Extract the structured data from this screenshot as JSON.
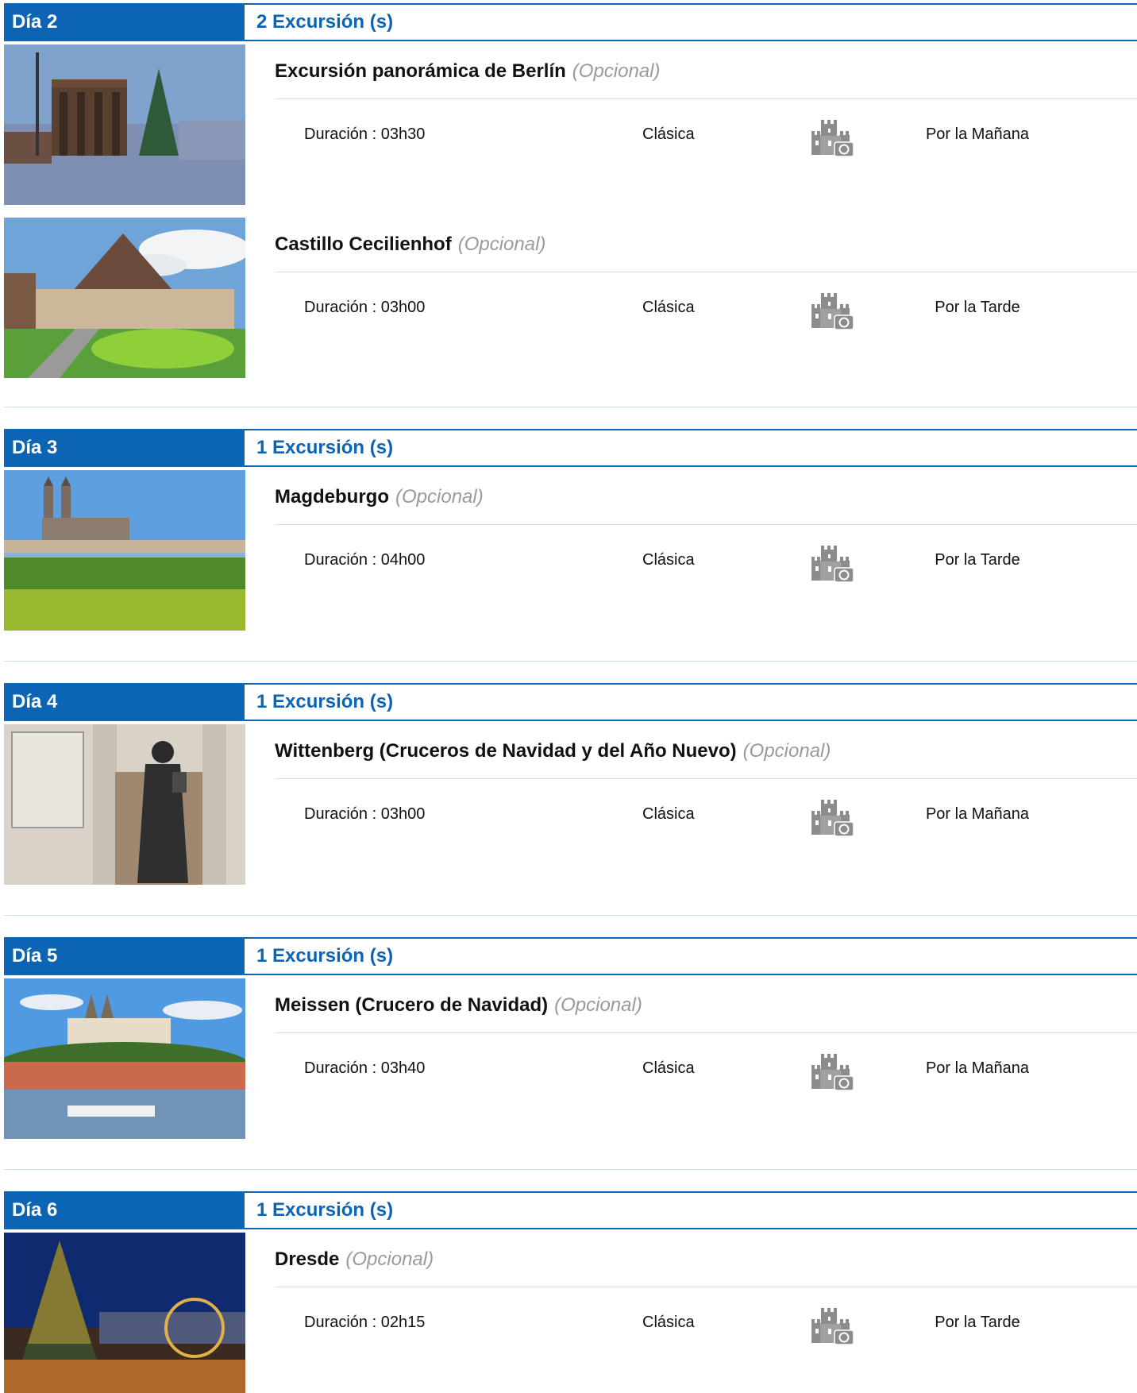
{
  "days": [
    {
      "label": "Día 2",
      "count": "2 Excursión (s)",
      "excursions": [
        {
          "name": "Excursión panorámica de Berlín",
          "optional": "(Opcional)",
          "duration": "Duración : 03h30",
          "type": "Clásica",
          "period": "Por la Mañana",
          "icon": "castle-camera-icon"
        },
        {
          "name": "Castillo Cecilienhof",
          "optional": "(Opcional)",
          "duration": "Duración : 03h00",
          "type": "Clásica",
          "period": "Por la Tarde",
          "icon": "castle-camera-icon"
        }
      ]
    },
    {
      "label": "Día 3",
      "count": "1 Excursión (s)",
      "excursions": [
        {
          "name": "Magdeburgo",
          "optional": "(Opcional)",
          "duration": "Duración : 04h00",
          "type": "Clásica",
          "period": "Por la Tarde",
          "icon": "castle-camera-icon"
        }
      ]
    },
    {
      "label": "Día 4",
      "count": "1 Excursión (s)",
      "excursions": [
        {
          "name": "Wittenberg (Cruceros de Navidad y del Año Nuevo)",
          "optional": "(Opcional)",
          "duration": "Duración : 03h00",
          "type": "Clásica",
          "period": "Por la Mañana",
          "icon": "castle-camera-icon"
        }
      ]
    },
    {
      "label": "Día 5",
      "count": "1 Excursión (s)",
      "excursions": [
        {
          "name": "Meissen (Crucero de Navidad)",
          "optional": "(Opcional)",
          "duration": "Duración : 03h40",
          "type": "Clásica",
          "period": "Por la Mañana",
          "icon": "castle-camera-icon"
        }
      ]
    },
    {
      "label": "Día 6",
      "count": "1 Excursión (s)",
      "excursions": [
        {
          "name": "Dresde",
          "optional": "(Opcional)",
          "duration": "Duración : 02h15",
          "type": "Clásica",
          "period": "Por la Tarde",
          "icon": "castle-camera-icon"
        }
      ]
    }
  ],
  "colors": {
    "header_blue": "#0c65b4",
    "optional_gray": "#9a9a9a",
    "icon_gray": "#8c8c8c"
  }
}
